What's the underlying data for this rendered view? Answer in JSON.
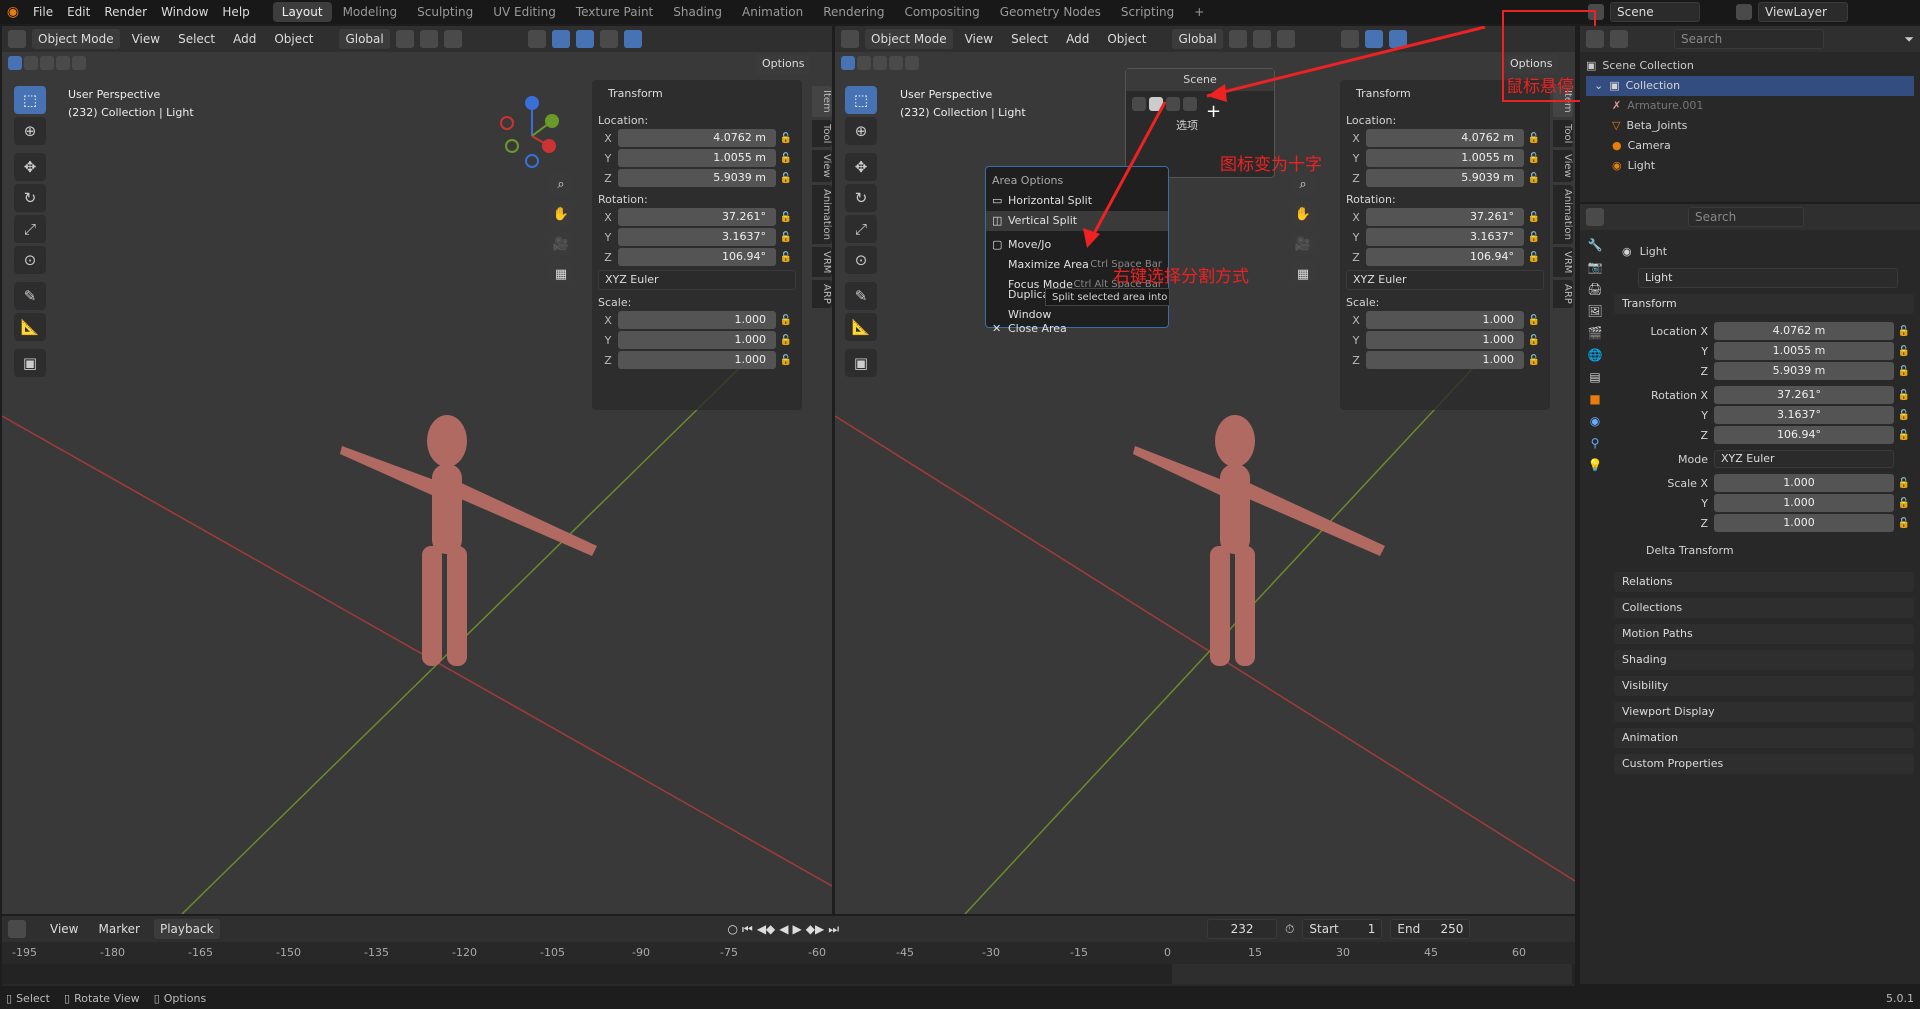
{
  "topmenu": {
    "items": [
      "File",
      "Edit",
      "Render",
      "Window",
      "Help"
    ],
    "workspaces": [
      "Layout",
      "Modeling",
      "Sculpting",
      "UV Editing",
      "Texture Paint",
      "Shading",
      "Animation",
      "Rendering",
      "Compositing",
      "Geometry Nodes",
      "Scripting"
    ],
    "active": "Layout",
    "scene": "Scene",
    "viewlayer": "ViewLayer"
  },
  "viewport_left": {
    "mode": "Object Mode",
    "menus": [
      "View",
      "Select",
      "Add",
      "Object"
    ],
    "orientation": "Global",
    "options": "Options",
    "perspective": "User Perspective",
    "collection": "(232) Collection | Light"
  },
  "viewport_right": {
    "mode": "Object Mode",
    "menus": [
      "View",
      "Select",
      "Add",
      "Object"
    ],
    "orientation": "Global",
    "options": "Options",
    "perspective": "User Perspective",
    "collection": "(232) Collection | Light"
  },
  "transform": {
    "title": "Transform",
    "location_label": "Location:",
    "rotation_label": "Rotation:",
    "scale_label": "Scale:",
    "loc": [
      "4.0762 m",
      "1.0055 m",
      "5.9039 m"
    ],
    "rot": [
      "37.261°",
      "3.1637°",
      "106.94°"
    ],
    "euler": "XYZ Euler",
    "scale": [
      "1.000",
      "1.000",
      "1.000"
    ],
    "axes": [
      "X",
      "Y",
      "Z"
    ]
  },
  "sidetabs": [
    "Item",
    "Tool",
    "View",
    "Animation",
    "VRM",
    "ARP"
  ],
  "popup_scene": {
    "title": "Scene",
    "option": "选项"
  },
  "area_menu": {
    "title": "Area Options",
    "items": [
      "Horizontal Split",
      "Vertical Split",
      "Move/Jo",
      "Maximize Area",
      "Focus Mode",
      "Duplicate Area into New Window",
      "Close Area"
    ],
    "shortcuts": {
      "maximize": "Ctrl Space Bar",
      "focus": "Ctrl Alt Space Bar"
    },
    "tooltip": "Split selected area into ne"
  },
  "annotations": {
    "hover": "鼠标悬停",
    "cross": "图标变为十字",
    "rightclick": "右键选择分割方式"
  },
  "outliner": {
    "search": "Search",
    "root": "Scene Collection",
    "collection": "Collection",
    "items": [
      "Armature.001",
      "Beta_Joints",
      "Camera",
      "Light"
    ]
  },
  "properties": {
    "search": "Search",
    "object": "Light",
    "datablock": "Light",
    "transform_title": "Transform",
    "loc_labels": [
      "Location X",
      "Y",
      "Z"
    ],
    "rot_labels": [
      "Rotation X",
      "Y",
      "Z"
    ],
    "mode_label": "Mode",
    "scale_labels": [
      "Scale X",
      "Y",
      "Z"
    ],
    "delta": "Delta Transform",
    "sections": [
      "Relations",
      "Collections",
      "Motion Paths",
      "Shading",
      "Visibility",
      "Viewport Display",
      "Animation",
      "Custom Properties"
    ]
  },
  "timeline": {
    "menus": [
      "View",
      "Marker",
      "Playback"
    ],
    "frame": "232",
    "start_label": "Start",
    "start": "1",
    "end_label": "End",
    "end": "250",
    "ticks": [
      "-195",
      "-180",
      "-165",
      "-150",
      "-135",
      "-120",
      "-105",
      "-90",
      "-75",
      "-60",
      "-45",
      "-30",
      "-15",
      "0",
      "15",
      "30",
      "45",
      "60"
    ]
  },
  "statusbar": {
    "items": [
      "Select",
      "Rotate View",
      "Options"
    ],
    "version": "5.0.1"
  }
}
